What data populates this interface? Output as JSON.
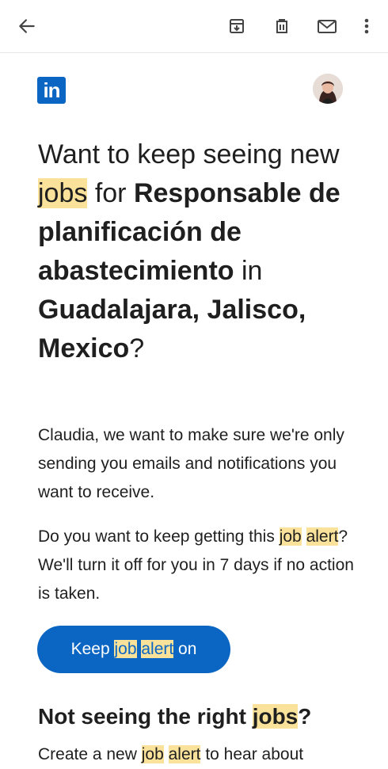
{
  "toolbar": {
    "back_icon": "arrow-left-icon",
    "archive_icon": "archive-icon",
    "delete_icon": "trash-icon",
    "mark_icon": "mail-icon",
    "more_icon": "more-vert-icon"
  },
  "email": {
    "logo_text": "in",
    "headline": {
      "part1": "Want to keep seeing new ",
      "jobs": "jobs",
      "part2": " for ",
      "role": "Responsable de planificación de abastecimiento",
      "in": " in ",
      "location": "Guadalajara, Jalisco, Mexico",
      "qmark": "?"
    },
    "para1": "Claudia, we want to make sure we're only sending you emails and notifications you want to receive.",
    "para2": {
      "a": "Do you want to keep getting this ",
      "job": "job",
      "space": " ",
      "alert": "alert",
      "b": "? We'll turn it off for you in 7 days if no action is taken."
    },
    "cta": {
      "keep": "Keep ",
      "job": "job",
      "alert": "alert",
      "on": " on"
    },
    "subheading": {
      "a": "Not seeing the right ",
      "jobs": "jobs",
      "q": "?"
    },
    "para3": {
      "a": "Create a new ",
      "job": "job",
      "alert": "alert",
      "b": " to hear about"
    }
  },
  "colors": {
    "brand": "#0a66c2",
    "highlight": "#fbe29a"
  }
}
